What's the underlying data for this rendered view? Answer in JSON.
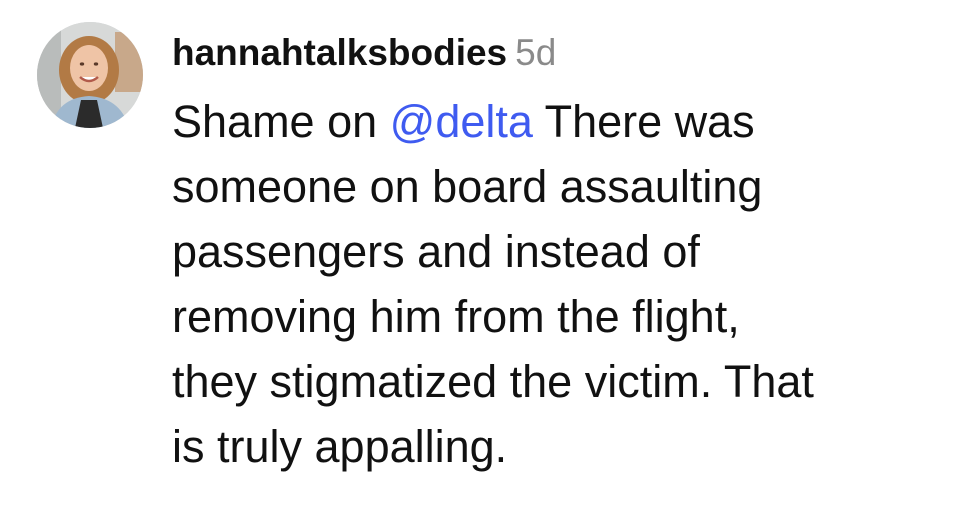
{
  "comment": {
    "avatar_icon": "user-avatar-photo",
    "username": "hannahtalksbodies",
    "timestamp": "5d",
    "body": {
      "line1_prefix": "Shame on ",
      "mention": "@delta",
      "line1_suffix": " There was",
      "line2": "someone on board assaulting",
      "line3": "passengers and instead of",
      "line4": "removing him from the flight,",
      "line5": "they stigmatized the victim. That",
      "line6": "is truly appalling."
    },
    "colors": {
      "text": "#111111",
      "timestamp": "#8a8a8a",
      "mention": "#3f5bf0"
    }
  }
}
